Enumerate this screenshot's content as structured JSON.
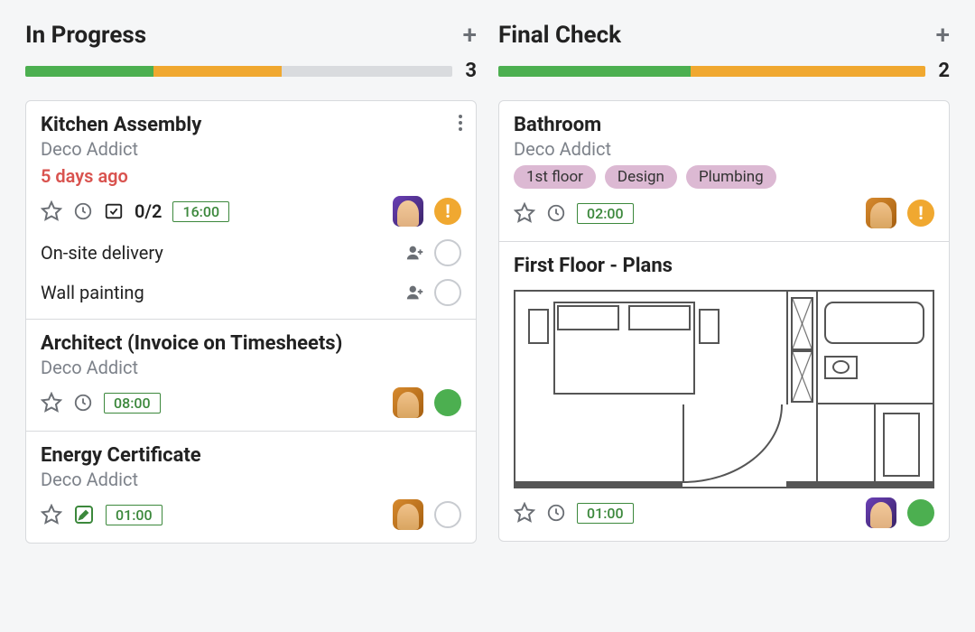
{
  "columns": [
    {
      "title": "In Progress",
      "count": "3",
      "progress": {
        "green": 30,
        "orange": 30,
        "gray": 40
      },
      "cards": [
        {
          "title": "Kitchen Assembly",
          "subtitle": "Deco Addict",
          "overdue": "5 days ago",
          "checklist": "0/2",
          "time": "16:00",
          "avatar": "purple",
          "status": "warn",
          "menu": true,
          "star": true,
          "clock": true,
          "checkbox": true,
          "subtasks": [
            {
              "text": "On-site delivery"
            },
            {
              "text": "Wall painting"
            }
          ]
        },
        {
          "title": "Architect (Invoice on Timesheets)",
          "subtitle": "Deco Addict",
          "time": "08:00",
          "avatar": "orange",
          "status": "green",
          "star": true,
          "clock": true
        },
        {
          "title": "Energy Certificate",
          "subtitle": "Deco Addict",
          "time": "01:00",
          "avatar": "orange",
          "status": "blank",
          "star": true,
          "editnote": true
        }
      ]
    },
    {
      "title": "Final Check",
      "count": "2",
      "progress": {
        "green": 45,
        "orange": 55,
        "gray": 0
      },
      "cards": [
        {
          "title": "Bathroom",
          "subtitle": "Deco Addict",
          "tags": [
            "1st floor",
            "Design",
            "Plumbing"
          ],
          "time": "02:00",
          "avatar": "orange",
          "status": "warn",
          "star": true,
          "clock": true
        },
        {
          "title": "First Floor - Plans",
          "floorplan": true,
          "time": "01:00",
          "avatar": "purple",
          "status": "green",
          "star": true,
          "clock": true
        }
      ]
    }
  ]
}
